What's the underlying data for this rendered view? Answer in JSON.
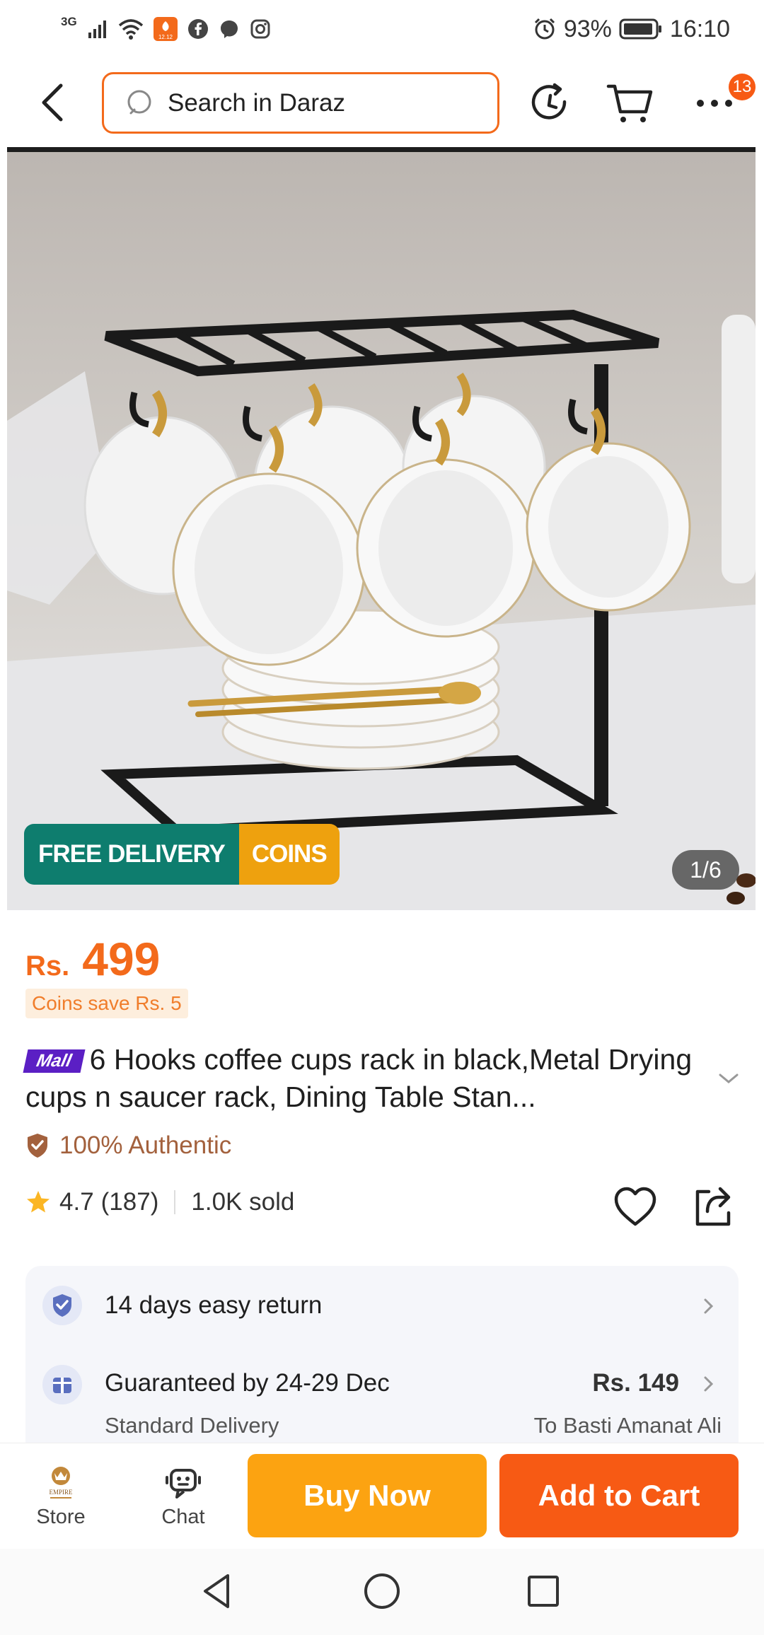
{
  "status_bar": {
    "network": "3G",
    "battery": "93%",
    "time": "16:10",
    "app_badge_text": "12.12"
  },
  "search": {
    "placeholder": "Search in Daraz"
  },
  "nav": {
    "cart_badge": "13"
  },
  "gallery": {
    "free_delivery": "FREE DELIVERY",
    "coins": "COINS",
    "counter": "1/6"
  },
  "product": {
    "currency": "Rs.",
    "price": "499",
    "coins_save": "Coins save Rs. 5",
    "mall_tag": "Mall",
    "title": "6 Hooks coffee cups rack in black,Metal Drying cups n saucer rack, Dining Table Stan...",
    "authentic": "100% Authentic",
    "rating": "4.7",
    "reviews": "(187)",
    "sold": "1.0K sold"
  },
  "info_card": {
    "return_text": "14 days easy return",
    "delivery_text": "Guaranteed by 24-29 Dec",
    "delivery_price": "Rs. 149",
    "delivery_type": "Standard Delivery",
    "delivery_to": "To Basti Amanat Ali"
  },
  "bottom_bar": {
    "store_label": "Store",
    "store_logo_text": "EMPIRE",
    "chat_label": "Chat",
    "buy_now": "Buy Now",
    "add_to_cart": "Add to Cart"
  },
  "colors": {
    "accent": "#f36a1b",
    "buy_now": "#fca311",
    "add_to_cart": "#f75a14",
    "free_delivery": "#0e7d6e",
    "coins": "#eea10e",
    "mall": "#5b1fc4"
  }
}
